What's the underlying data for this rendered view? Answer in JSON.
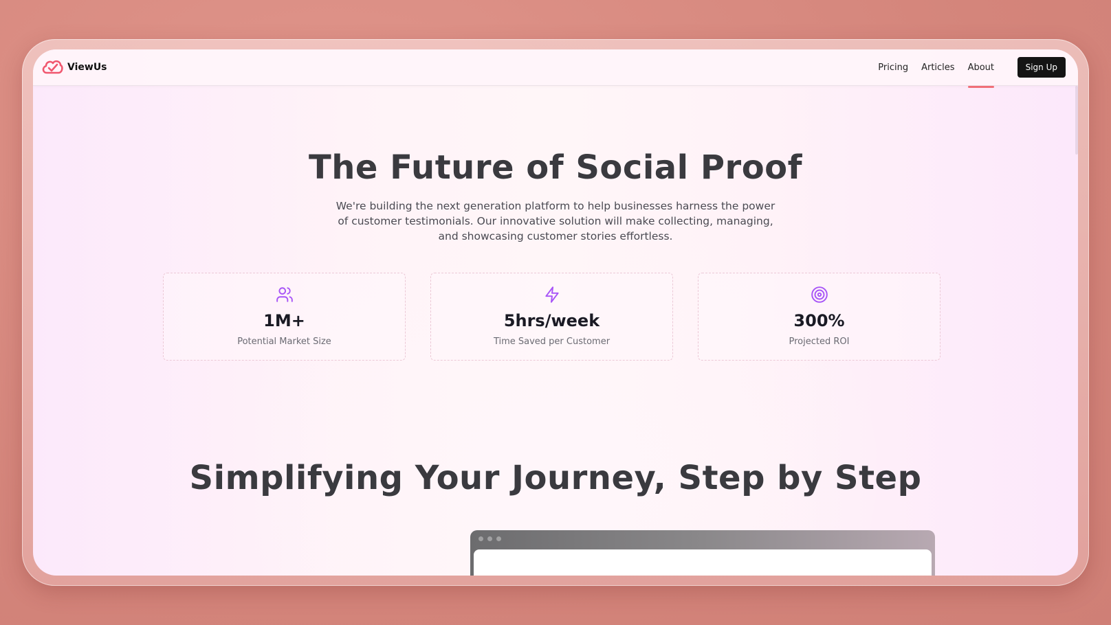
{
  "brand": {
    "name": "ViewUs",
    "color": "#f0566e"
  },
  "nav": {
    "links": [
      {
        "label": "Pricing"
      },
      {
        "label": "Articles"
      },
      {
        "label": "About",
        "active": true
      }
    ],
    "signup_label": "Sign Up"
  },
  "hero": {
    "title": "The Future of Social Proof",
    "subtitle": "We're building the next generation platform to help businesses harness the power of customer testimonials. Our innovative solution will make collecting, managing, and showcasing customer stories effortless."
  },
  "stats": [
    {
      "icon": "users-icon",
      "value": "1M+",
      "label": "Potential Market Size"
    },
    {
      "icon": "lightning-icon",
      "value": "5hrs/week",
      "label": "Time Saved per Customer"
    },
    {
      "icon": "target-icon",
      "value": "300%",
      "label": "Projected ROI"
    }
  ],
  "section": {
    "title": "Simplifying Your Journey, Step by Step"
  },
  "colors": {
    "accent": "#a855f7",
    "nav_underline": "#f06f78",
    "button_bg": "#141414"
  }
}
